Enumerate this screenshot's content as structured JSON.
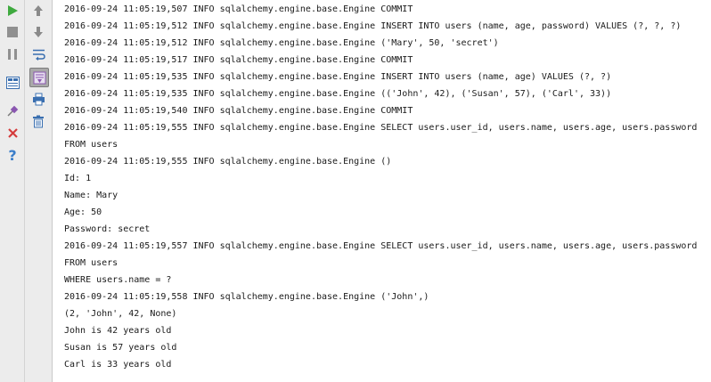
{
  "toolbar": {
    "left_column": [
      {
        "icon": "run-icon",
        "color": "#3faa3f"
      },
      {
        "icon": "stop-icon",
        "color": "#909090"
      },
      {
        "icon": "pause-icon",
        "color": "#909090"
      },
      {
        "icon": "layout-icon",
        "color": "#3a6fb0"
      },
      {
        "icon": "pin-icon",
        "color": "#8a56b0"
      },
      {
        "icon": "close-icon",
        "color": "#d43c3c"
      },
      {
        "icon": "help-icon",
        "color": "#3a7dc9"
      }
    ],
    "right_column": [
      {
        "icon": "arrow-up-icon",
        "color": "#8a8a8a"
      },
      {
        "icon": "arrow-down-icon",
        "color": "#8a8a8a"
      },
      {
        "icon": "soft-wrap-icon",
        "color": "#3a6fb0"
      },
      {
        "icon": "scroll-to-end-icon",
        "color": "#8a56b0",
        "active": true
      },
      {
        "icon": "print-icon",
        "color": "#3a6fb0"
      },
      {
        "icon": "trash-icon",
        "color": "#3a6fb0"
      }
    ]
  },
  "console": {
    "lines": [
      "2016-09-24 11:05:19,507 INFO sqlalchemy.engine.base.Engine COMMIT",
      "2016-09-24 11:05:19,512 INFO sqlalchemy.engine.base.Engine INSERT INTO users (name, age, password) VALUES (?, ?, ?)",
      "2016-09-24 11:05:19,512 INFO sqlalchemy.engine.base.Engine ('Mary', 50, 'secret')",
      "2016-09-24 11:05:19,517 INFO sqlalchemy.engine.base.Engine COMMIT",
      "2016-09-24 11:05:19,535 INFO sqlalchemy.engine.base.Engine INSERT INTO users (name, age) VALUES (?, ?)",
      "2016-09-24 11:05:19,535 INFO sqlalchemy.engine.base.Engine (('John', 42), ('Susan', 57), ('Carl', 33))",
      "2016-09-24 11:05:19,540 INFO sqlalchemy.engine.base.Engine COMMIT",
      "2016-09-24 11:05:19,555 INFO sqlalchemy.engine.base.Engine SELECT users.user_id, users.name, users.age, users.password",
      "FROM users",
      "2016-09-24 11:05:19,555 INFO sqlalchemy.engine.base.Engine ()",
      "Id: 1",
      "Name: Mary",
      "Age: 50",
      "Password: secret",
      "2016-09-24 11:05:19,557 INFO sqlalchemy.engine.base.Engine SELECT users.user_id, users.name, users.age, users.password",
      "FROM users",
      "WHERE users.name = ?",
      "2016-09-24 11:05:19,558 INFO sqlalchemy.engine.base.Engine ('John',)",
      "(2, 'John', 42, None)",
      "John is 42 years old",
      "Susan is 57 years old",
      "Carl is 33 years old"
    ]
  }
}
